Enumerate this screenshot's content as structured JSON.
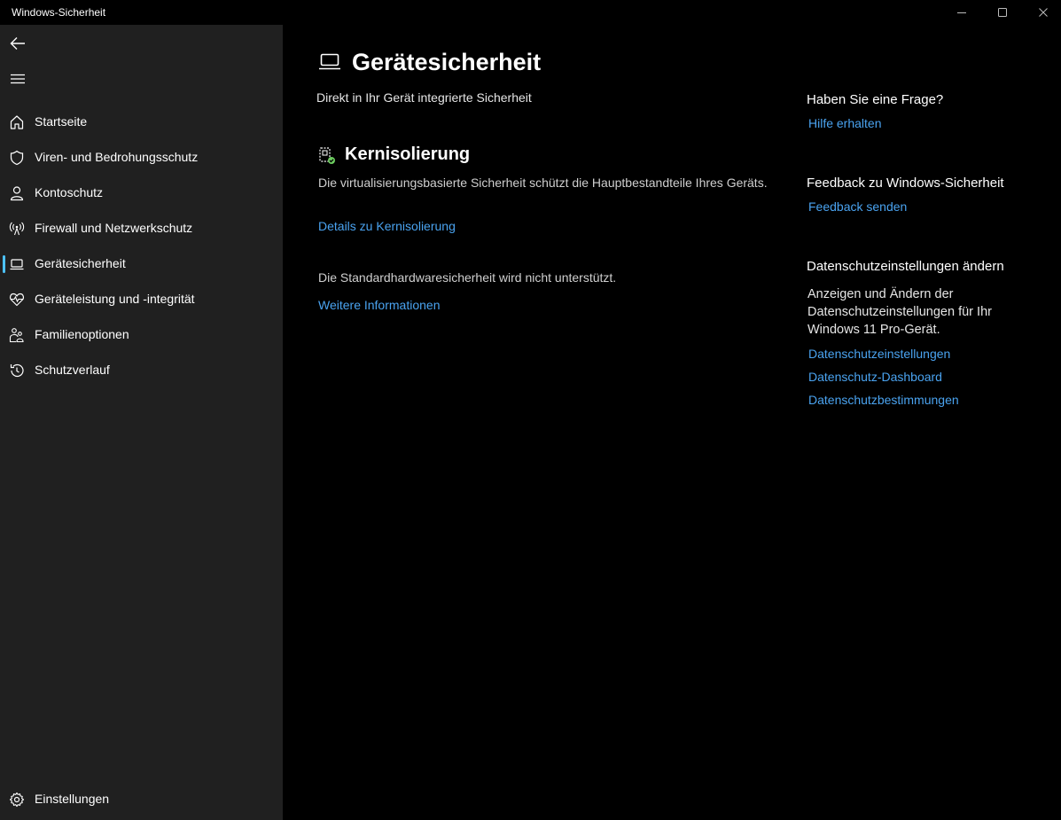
{
  "window": {
    "title": "Windows-Sicherheit"
  },
  "sidebar": {
    "items": [
      {
        "label": "Startseite",
        "icon": "home-icon"
      },
      {
        "label": "Viren- und Bedrohungsschutz",
        "icon": "shield-icon"
      },
      {
        "label": "Kontoschutz",
        "icon": "person-icon"
      },
      {
        "label": "Firewall und Netzwerkschutz",
        "icon": "antenna-icon"
      },
      {
        "label": "Gerätesicherheit",
        "icon": "laptop-icon",
        "selected": true
      },
      {
        "label": "Geräteleistung und -integrität",
        "icon": "heart-pulse-icon"
      },
      {
        "label": "Familienoptionen",
        "icon": "family-icon"
      },
      {
        "label": "Schutzverlauf",
        "icon": "history-icon"
      }
    ],
    "settings_label": "Einstellungen"
  },
  "main": {
    "title": "Gerätesicherheit",
    "subtitle": "Direkt in Ihr Gerät integrierte Sicherheit",
    "core_isolation": {
      "title": "Kernisolierung",
      "description": "Die virtualisierungsbasierte Sicherheit schützt die Hauptbestandteile Ihres Geräts.",
      "link": "Details zu Kernisolierung"
    },
    "hardware": {
      "text": "Die Standardhardwaresicherheit wird nicht unterstützt.",
      "link": "Weitere Informationen"
    }
  },
  "right_panel": {
    "question_heading": "Haben Sie eine Frage?",
    "help_link": "Hilfe erhalten",
    "feedback_heading": "Feedback zu Windows-Sicherheit",
    "feedback_link": "Feedback senden",
    "privacy_heading": "Datenschutzeinstellungen ändern",
    "privacy_text": "Anzeigen und Ändern der Datenschutzeinstellungen für Ihr Windows 11 Pro-Gerät.",
    "privacy_links": [
      "Datenschutzeinstellungen",
      "Datenschutz-Dashboard",
      "Datenschutzbestimmungen"
    ]
  },
  "colors": {
    "accent": "#4cc2ff",
    "link": "#4aa3f0",
    "sidebar_bg": "#202020",
    "main_bg": "#000000",
    "status_ok": "#6ccb5f"
  }
}
